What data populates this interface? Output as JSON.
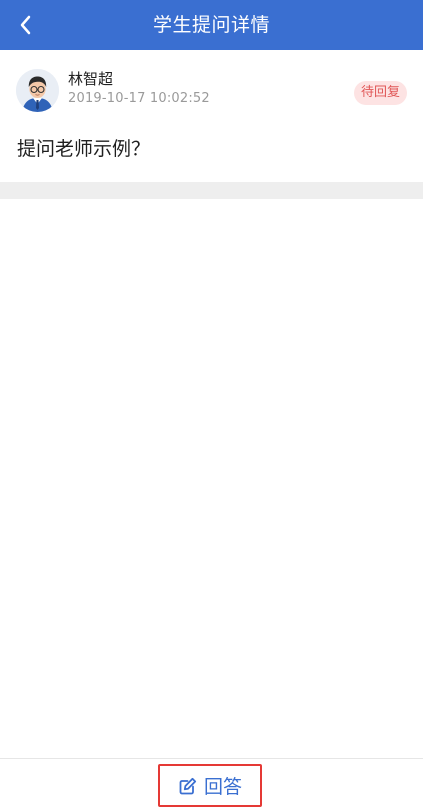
{
  "header": {
    "title": "学生提问详情",
    "back_icon": "chevron-left-icon",
    "background_color": "#3a6fd1"
  },
  "question": {
    "user_name": "林智超",
    "time": "2019-10-17 10:02:52",
    "status": "待回复",
    "text": "提问老师示例？",
    "avatar_icon": "avatar-icon"
  },
  "bottom_bar": {
    "answer_label": "回答",
    "answer_icon": "edit-icon",
    "accent_color": "#3a6fd1",
    "highlight_color": "#e53935"
  }
}
